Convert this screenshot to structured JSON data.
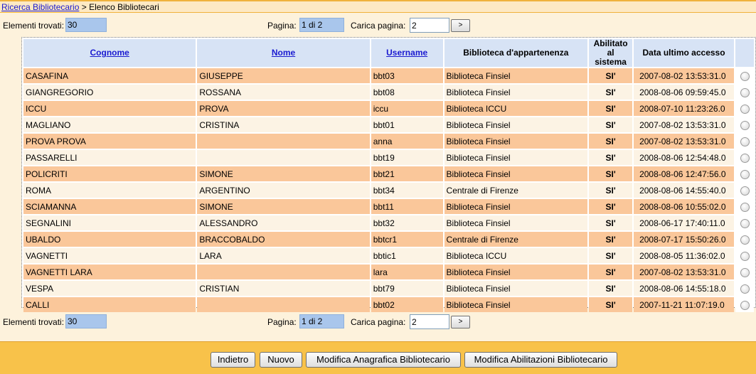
{
  "breadcrumb": {
    "link": "Ricerca Bibliotecario",
    "separator": ">",
    "current": "Elenco Bibliotecari"
  },
  "pager_top": {
    "found_label": "Elementi trovati:",
    "found_value": "30",
    "page_label": "Pagina:",
    "page_value": "1 di 2",
    "load_label": "Carica pagina:",
    "load_value": "2",
    "go_label": ">"
  },
  "pager_bottom": {
    "found_label": "Elementi trovati:",
    "found_value": "30",
    "page_label": "Pagina:",
    "page_value": "1 di 2",
    "load_label": "Carica pagina:",
    "load_value": "2",
    "go_label": ">"
  },
  "table": {
    "headers": {
      "cognome": "Cognome",
      "nome": "Nome",
      "username": "Username",
      "biblioteca": "Biblioteca d'appartenenza",
      "abilitato_1": "Abilitato al",
      "abilitato_2": "sistema",
      "data": "Data ultimo accesso"
    },
    "rows": [
      {
        "cognome": "CASAFINA",
        "nome": "GIUSEPPE",
        "username": "bbt03",
        "biblioteca": "Biblioteca Finsiel",
        "abilitato": "SI'",
        "data": "2007-08-02 13:53:31.0"
      },
      {
        "cognome": "GIANGREGORIO",
        "nome": "ROSSANA",
        "username": "bbt08",
        "biblioteca": "Biblioteca Finsiel",
        "abilitato": "SI'",
        "data": "2008-08-06 09:59:45.0"
      },
      {
        "cognome": "ICCU",
        "nome": "PROVA",
        "username": "iccu",
        "biblioteca": "Biblioteca ICCU",
        "abilitato": "SI'",
        "data": "2008-07-10 11:23:26.0"
      },
      {
        "cognome": "MAGLIANO",
        "nome": "CRISTINA",
        "username": "bbt01",
        "biblioteca": "Biblioteca Finsiel",
        "abilitato": "SI'",
        "data": "2007-08-02 13:53:31.0"
      },
      {
        "cognome": "PROVA PROVA",
        "nome": "",
        "username": "anna",
        "biblioteca": "Biblioteca Finsiel",
        "abilitato": "SI'",
        "data": "2007-08-02 13:53:31.0"
      },
      {
        "cognome": "PASSARELLI",
        "nome": "",
        "username": "bbt19",
        "biblioteca": "Biblioteca Finsiel",
        "abilitato": "SI'",
        "data": "2008-08-06 12:54:48.0"
      },
      {
        "cognome": "POLICRITI",
        "nome": "SIMONE",
        "username": "bbt21",
        "biblioteca": "Biblioteca Finsiel",
        "abilitato": "SI'",
        "data": "2008-08-06 12:47:56.0"
      },
      {
        "cognome": "ROMA",
        "nome": "ARGENTINO",
        "username": "bbt34",
        "biblioteca": "Centrale di Firenze",
        "abilitato": "SI'",
        "data": "2008-08-06 14:55:40.0"
      },
      {
        "cognome": "SCIAMANNA",
        "nome": "SIMONE",
        "username": "bbt11",
        "biblioteca": "Biblioteca Finsiel",
        "abilitato": "SI'",
        "data": "2008-08-06 10:55:02.0"
      },
      {
        "cognome": "SEGNALINI",
        "nome": "ALESSANDRO",
        "username": "bbt32",
        "biblioteca": "Biblioteca Finsiel",
        "abilitato": "SI'",
        "data": "2008-06-17 17:40:11.0"
      },
      {
        "cognome": "UBALDO",
        "nome": "BRACCOBALDO",
        "username": "bbtcr1",
        "biblioteca": "Centrale di Firenze",
        "abilitato": "SI'",
        "data": "2008-07-17 15:50:26.0"
      },
      {
        "cognome": "VAGNETTI",
        "nome": "LARA",
        "username": "bbtic1",
        "biblioteca": "Biblioteca ICCU",
        "abilitato": "SI'",
        "data": "2008-08-05 11:36:02.0"
      },
      {
        "cognome": "VAGNETTI LARA",
        "nome": "",
        "username": "lara",
        "biblioteca": "Biblioteca Finsiel",
        "abilitato": "SI'",
        "data": "2007-08-02 13:53:31.0"
      },
      {
        "cognome": "VESPA",
        "nome": "CRISTIAN",
        "username": "bbt79",
        "biblioteca": "Biblioteca Finsiel",
        "abilitato": "SI'",
        "data": "2008-08-06 14:55:18.0"
      },
      {
        "cognome": "CALLI",
        "nome": "",
        "username": "bbt02",
        "biblioteca": "Biblioteca Finsiel",
        "abilitato": "SI'",
        "data": "2007-11-21 11:07:19.0"
      }
    ]
  },
  "buttons": {
    "indietro": "Indietro",
    "nuovo": "Nuovo",
    "modifica_anagrafica": "Modifica Anagrafica Bibliotecario",
    "modifica_abilitazioni": "Modifica Abilitazioni Bibliotecario"
  },
  "colors": {
    "row_odd": "#fac79a",
    "row_even": "#fcf3e4",
    "header": "#d7e3f5",
    "footer": "#f8c24a",
    "page_bg": "#fdf2dc",
    "link": "#1a1ad0"
  }
}
